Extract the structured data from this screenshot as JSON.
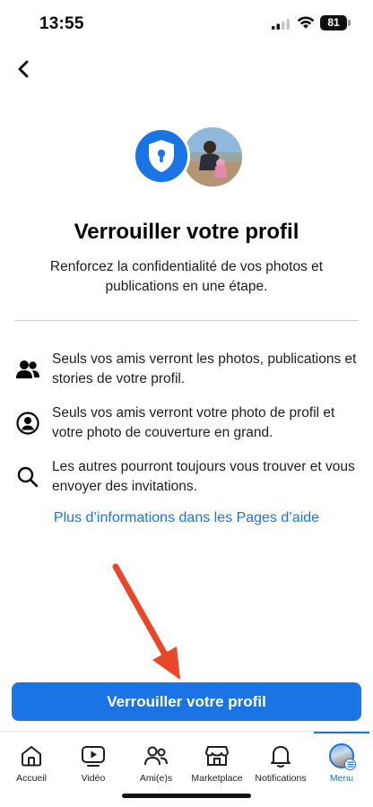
{
  "status_bar": {
    "time": "13:55",
    "battery": "81"
  },
  "page": {
    "title": "Verrouiller votre profil",
    "subtitle": "Renforcez la confidentialité de vos photos et publications en une étape."
  },
  "features": [
    {
      "icon": "friends-icon",
      "text": "Seuls vos amis verront les photos, publications et stories de votre profil."
    },
    {
      "icon": "profile-circle-icon",
      "text": "Seuls vos amis verront votre photo de profil et votre photo de couverture en grand."
    },
    {
      "icon": "search-icon",
      "text": "Les autres pourront toujours vous trouver et vous envoyer des invitations."
    }
  ],
  "help_link": "Plus d’informations dans les Pages d’aide",
  "primary_button": "Verrouiller votre profil",
  "tabs": [
    {
      "label": "Accueil",
      "icon": "home-icon"
    },
    {
      "label": "Vidéo",
      "icon": "video-icon"
    },
    {
      "label": "Ami(e)s",
      "icon": "friends-icon"
    },
    {
      "label": "Marketplace",
      "icon": "marketplace-icon"
    },
    {
      "label": "Notifications",
      "icon": "bell-icon"
    },
    {
      "label": "Menu",
      "icon": "avatar",
      "active": true
    }
  ],
  "colors": {
    "accent": "#1b74e4",
    "arrow": "#e8472a",
    "text": "#050505"
  }
}
